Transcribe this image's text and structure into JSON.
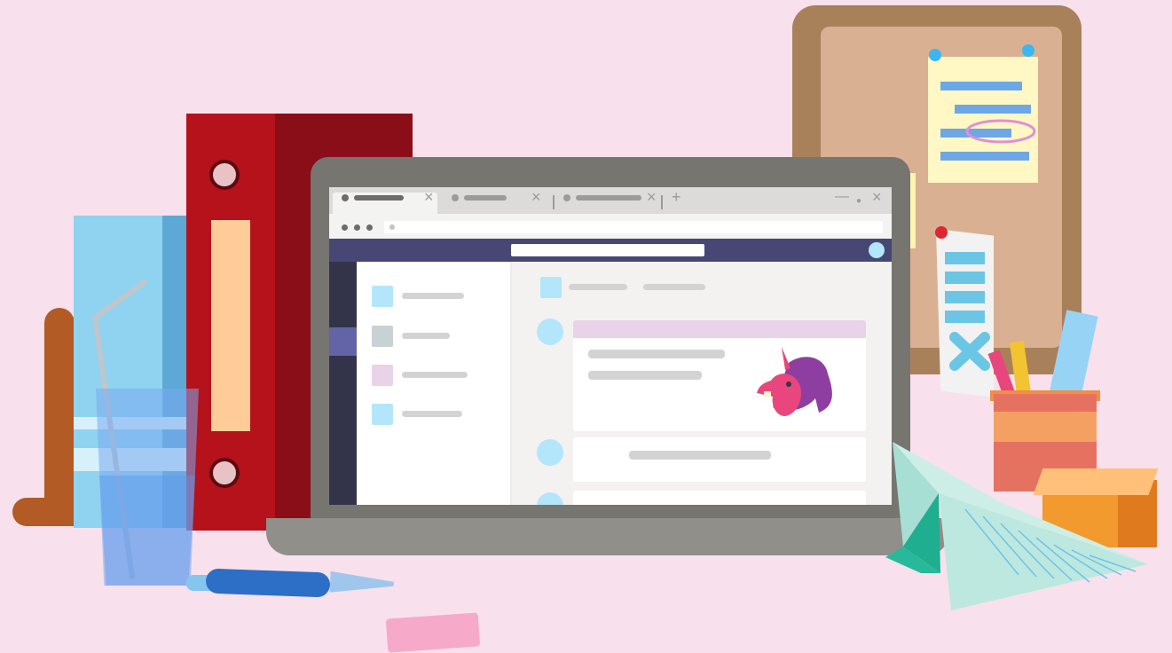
{
  "colors": {
    "background": "#f8e1ec",
    "app_header": "#464775",
    "app_rail": "#33344a",
    "app_rail_active": "#6264a7",
    "card_header": "#e8d3e8",
    "avatar": "#b3e6fb"
  },
  "browser": {
    "tabs": [
      {
        "state": "active",
        "close_glyph": "×"
      },
      {
        "state": "inactive",
        "close_glyph": "×"
      },
      {
        "state": "inactive",
        "close_glyph": "×"
      }
    ],
    "new_tab_glyph": "+",
    "window_controls": [
      "—",
      "●",
      "×"
    ]
  },
  "app": {
    "sidebar_items": [
      {
        "icon_color": "#b3e6fb"
      },
      {
        "icon_color": "#c8d1d3"
      },
      {
        "icon_color": "#e8d3e8"
      },
      {
        "icon_color": "#b3e6fb"
      }
    ],
    "messages": [
      {
        "has_header": true,
        "has_image": true,
        "image_name": "unicorn-illustration"
      },
      {
        "has_header": false,
        "has_image": false
      },
      {
        "has_header": false,
        "has_image": false
      }
    ]
  },
  "illustration_objects": [
    "laptop",
    "red-binder",
    "blue-book",
    "wooden-bookend",
    "drinking-glass",
    "corkboard",
    "sticky-note",
    "receipt",
    "pencil-cup",
    "ruler",
    "paper-airplane",
    "orange-box",
    "pen",
    "eraser"
  ]
}
